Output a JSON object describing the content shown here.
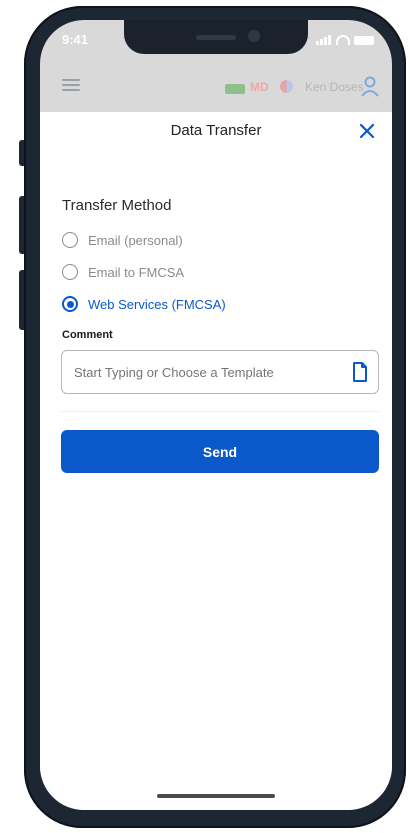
{
  "status_bar": {
    "time": "9:41"
  },
  "app_bar": {
    "driver_code": "MD",
    "user_name": "Ken Doses"
  },
  "modal": {
    "title": "Data Transfer",
    "section_label": "Transfer Method",
    "options": [
      {
        "label": "Email (personal)",
        "selected": false
      },
      {
        "label": "Email to FMCSA",
        "selected": false
      },
      {
        "label": "Web Services (FMCSA)",
        "selected": true
      }
    ],
    "comment": {
      "label": "Comment",
      "placeholder": "Start Typing or Choose a Template",
      "value": ""
    },
    "send_label": "Send"
  },
  "colors": {
    "accent": "#0a58ca",
    "frame": "#1d2633"
  },
  "icons": {
    "menu": "hamburger-icon",
    "truck": "truck-icon",
    "flag": "flag-icon",
    "user": "user-icon",
    "close": "close-icon",
    "template": "document-icon"
  }
}
